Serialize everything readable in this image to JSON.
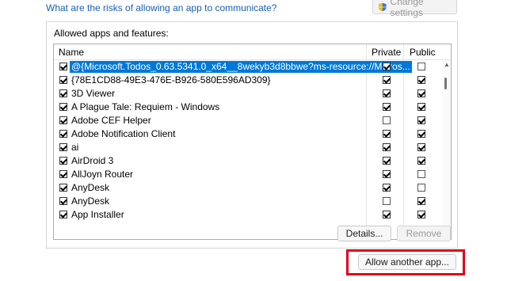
{
  "top": {
    "risk_link": "What are the risks of allowing an app to communicate?",
    "change_settings": "Change settings"
  },
  "group": {
    "label": "Allowed apps and features:",
    "columns": {
      "name": "Name",
      "private": "Private",
      "public": "Public"
    },
    "rows": [
      {
        "name": "@{Microsoft.Todos_0.63.5341.0_x64__8wekyb3d8bbwe?ms-resource://Micros...",
        "enabled": true,
        "private": true,
        "public": false,
        "selected": true
      },
      {
        "name": "{78E1CD88-49E3-476E-B926-580E596AD309}",
        "enabled": true,
        "private": true,
        "public": true,
        "selected": false
      },
      {
        "name": "3D Viewer",
        "enabled": true,
        "private": true,
        "public": true,
        "selected": false
      },
      {
        "name": "A Plague Tale: Requiem - Windows",
        "enabled": true,
        "private": true,
        "public": true,
        "selected": false
      },
      {
        "name": "Adobe CEF Helper",
        "enabled": true,
        "private": false,
        "public": true,
        "selected": false
      },
      {
        "name": "Adobe Notification Client",
        "enabled": true,
        "private": true,
        "public": true,
        "selected": false
      },
      {
        "name": "ai",
        "enabled": true,
        "private": true,
        "public": true,
        "selected": false
      },
      {
        "name": "AirDroid 3",
        "enabled": true,
        "private": true,
        "public": true,
        "selected": false
      },
      {
        "name": "AllJoyn Router",
        "enabled": true,
        "private": true,
        "public": false,
        "selected": false
      },
      {
        "name": "AnyDesk",
        "enabled": true,
        "private": true,
        "public": false,
        "selected": false
      },
      {
        "name": "AnyDesk",
        "enabled": true,
        "private": false,
        "public": true,
        "selected": false
      },
      {
        "name": "App Installer",
        "enabled": true,
        "private": true,
        "public": true,
        "selected": false
      }
    ],
    "details_button": "Details...",
    "remove_button": "Remove"
  },
  "allow_another_button": "Allow another app...",
  "colors": {
    "link": "#1a5fb4",
    "selection": "#0078d7",
    "highlight": "#e0001b"
  }
}
